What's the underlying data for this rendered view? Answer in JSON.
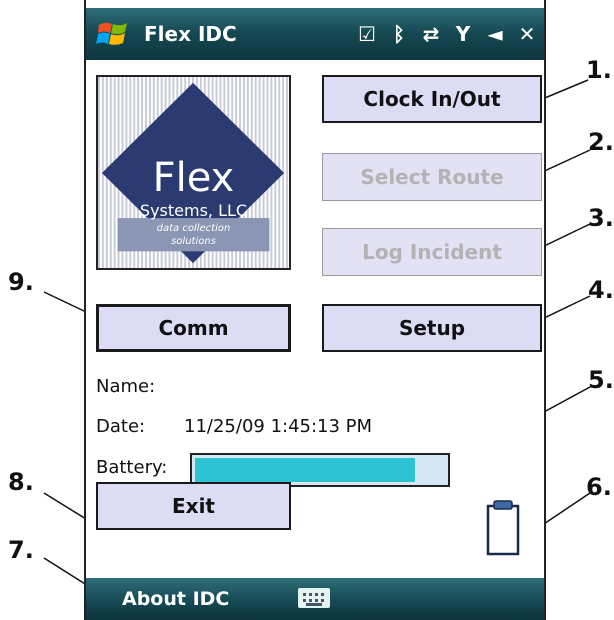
{
  "window": {
    "title": "Flex IDC",
    "status_icons": [
      "checkbox-icon",
      "bluetooth-icon",
      "sync-arrows-icon",
      "signal-antenna-icon",
      "speaker-icon",
      "close-icon"
    ]
  },
  "logo": {
    "brand": "Flex",
    "company": "Systems, LLC",
    "tagline_line1": "data collection",
    "tagline_line2": "solutions"
  },
  "buttons": {
    "clock": "Clock In/Out",
    "route": "Select Route",
    "incident": "Log Incident",
    "comm": "Comm",
    "setup": "Setup",
    "exit": "Exit"
  },
  "info": {
    "name_label": "Name:",
    "name_value": "",
    "date_label": "Date:",
    "date_value": "11/25/09 1:45:13 PM",
    "battery_label": "Battery:",
    "battery_level": 0.88
  },
  "bottom_bar": {
    "left_label": "About IDC"
  },
  "callouts": [
    "1.",
    "2.",
    "3.",
    "4.",
    "5.",
    "6.",
    "7.",
    "8.",
    "9."
  ],
  "colors": {
    "titlebar": "#174a54",
    "button_bg": "#dcdcf4",
    "battery_fill": "#2ec3d2"
  }
}
